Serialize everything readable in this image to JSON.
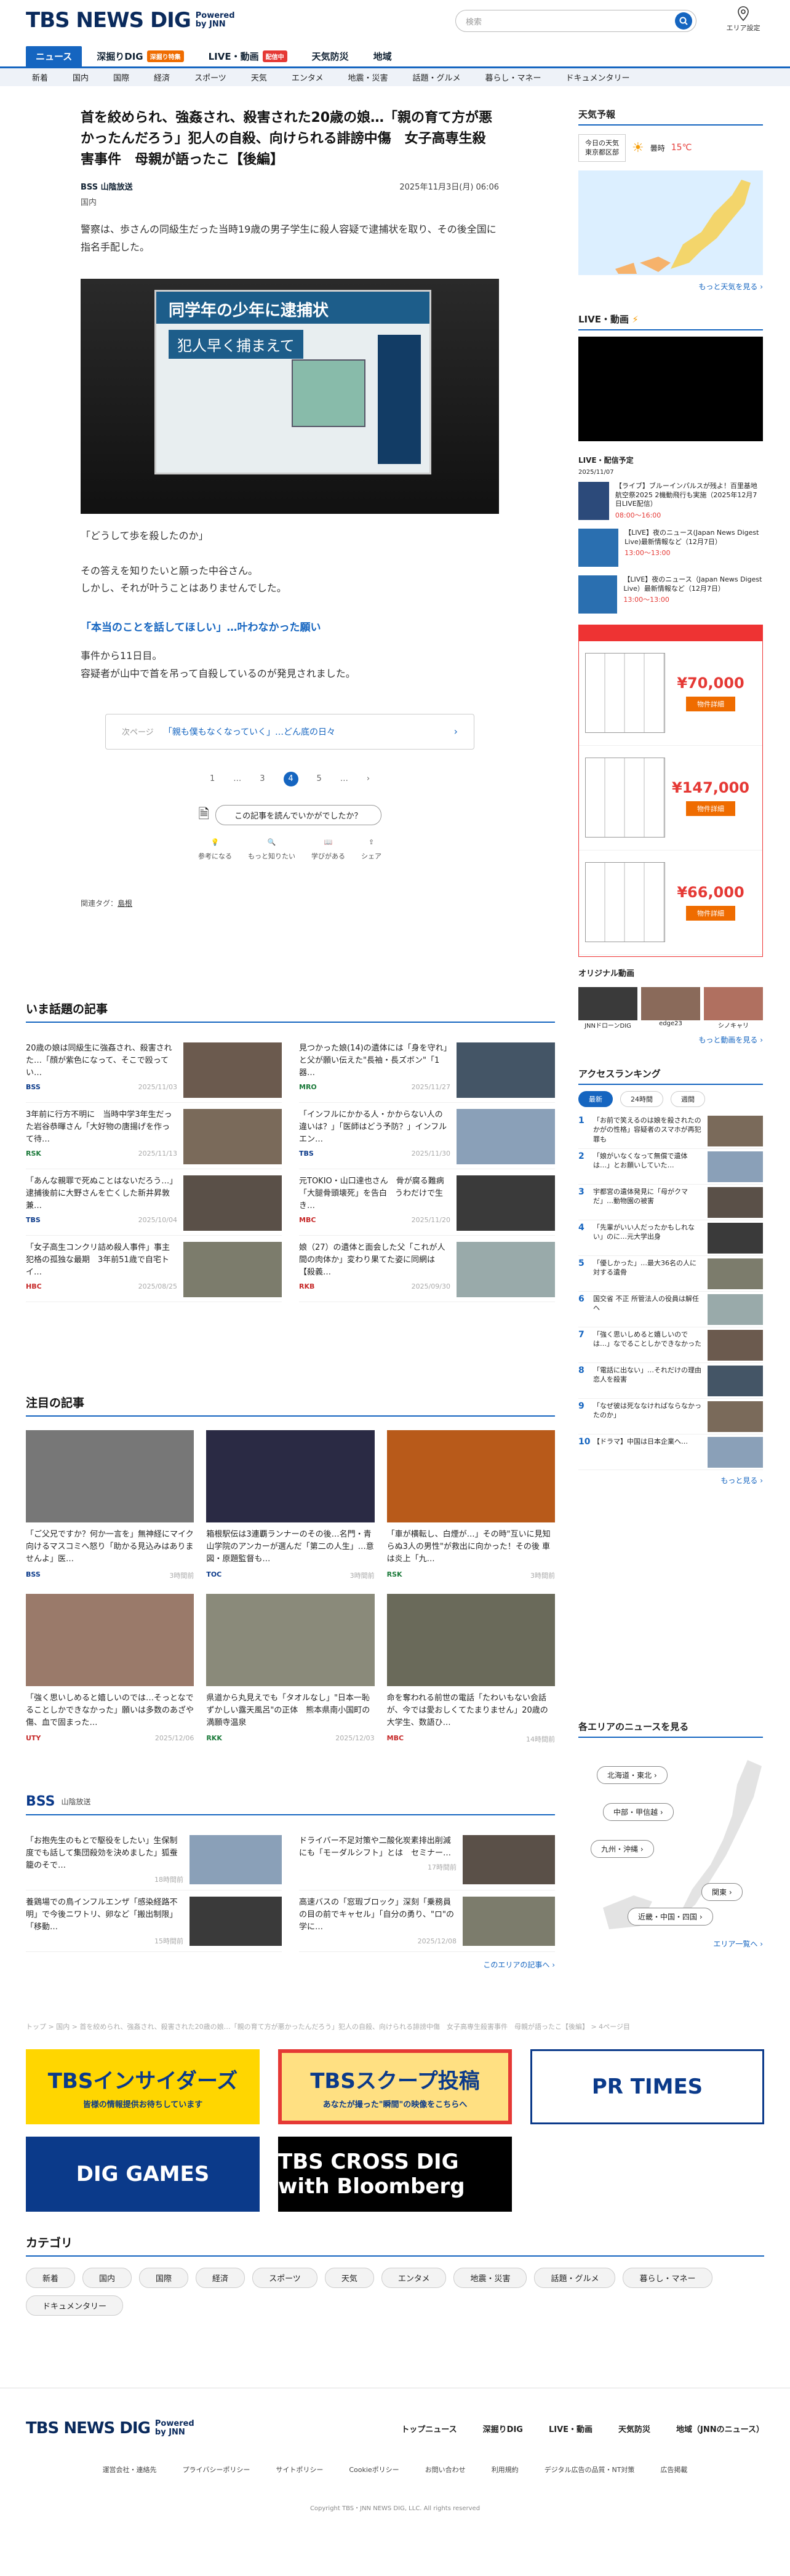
{
  "header": {
    "logo": "TBS NEWS DIG",
    "powered": "Powered by JNN",
    "search_placeholder": "検索",
    "area_label": "エリア設定"
  },
  "nav1": [
    {
      "label": "ニュース",
      "active": true
    },
    {
      "label": "深掘りDIG",
      "badge": "深掘り特集",
      "badge_color": "#ef6c00"
    },
    {
      "label": "LIVE・動画",
      "badge": "配信中",
      "badge_color": "#e53935"
    },
    {
      "label": "天気防災"
    },
    {
      "label": "地域"
    }
  ],
  "nav2": [
    "新着",
    "国内",
    "国際",
    "経済",
    "スポーツ",
    "天気",
    "エンタメ",
    "地震・災害",
    "話題・グルメ",
    "暮らし・マネー",
    "ドキュメンタリー"
  ],
  "article": {
    "title": "首を絞められ、強姦され、殺害された20歳の娘…「親の育て方が悪かったんだろう」犯人の自殺、向けられる誹謗中傷　女子高専生殺害事件　母親が語ったこ【後編】",
    "source": "BSS 山陰放送",
    "date": "2025年11月3日(月) 06:06",
    "category": "国内",
    "lead": "警察は、歩さんの同級生だった当時19歳の男子学生に殺人容疑で逮捕状を取り、その後全国に指名手配した。",
    "photo_band": "同学年の少年に逮捕状",
    "photo_band2": "犯人早く捕まえて",
    "p1": "「どうして歩を殺したのか」",
    "p2": "その答えを知りたいと願った中谷さん。",
    "p3": "しかし、それが叶うことはありませんでした。",
    "sub": "「本当のことを話してほしい」…叶わなかった願い",
    "p4": "事件から11日目。",
    "p5": "容疑者が山中で首を吊って自殺しているのが発見されました。",
    "next_label": "次ページ",
    "next_text": "「親も僕もなくなっていく」…どん底の日々",
    "pages": [
      "1",
      "…",
      "3",
      "4",
      "5",
      "…"
    ],
    "current_page": "4",
    "rate_q": "この記事を読んでいかがでしたか？",
    "reacts": [
      "参考になる",
      "もっと知りたい",
      "学びがある",
      "シェア"
    ],
    "tags_label": "関連タグ：",
    "tag": "島根"
  },
  "trending": {
    "title": "いま話題の記事",
    "items": [
      {
        "text": "20歳の娘は同級生に強姦され、殺害された…「顔が紫色になって、そこで殴ってい…",
        "src": "BSS",
        "date": "2025/11/03"
      },
      {
        "text": "見つかった娘(14)の遺体には「身を守れ」と父が願い伝えた\"長袖・長ズボン\"「1器…",
        "src": "MRO",
        "date": "2025/11/27"
      },
      {
        "text": "3年前に行方不明に　当時中学3年生だった岩谷恭暉さん「大好物の唐揚げを作って待…",
        "src": "RSK",
        "date": "2025/11/13"
      },
      {
        "text": "「インフルにかかる人・かからない人の違いは？」「医師はどう予防？」インフルエン…",
        "src": "TBS",
        "date": "2025/11/30"
      },
      {
        "text": "「あんな親罪で死ぬことはないだろう…」逮捕後前に大野さんを亡くした新井昇敦兼…",
        "src": "TBS",
        "date": "2025/10/04"
      },
      {
        "text": "元TOKIO・山口達也さん　骨が腐る難病「大腿骨頭壊死」を告白　うわだけで生き…",
        "src": "MBC",
        "date": "2025/11/20"
      },
      {
        "text": "「女子高生コンクリ詰め殺人事件」事主犯格の孤独な最期　3年前51歳で自宅トイ…",
        "src": "HBC",
        "date": "2025/08/25"
      },
      {
        "text": "娘（27）の遺体と面会した父「これが人間の肉体か」変わり果てた姿に同網は【殺義…",
        "src": "RKB",
        "date": "2025/09/30"
      }
    ]
  },
  "featured": {
    "title": "注目の記事",
    "items": [
      {
        "text": "「ご父兄ですか？何か一言を」無神経にマイク向けるマスコミへ怒り「助かる見込みはありませんよ」医…",
        "src": "BSS",
        "date": "3時間前"
      },
      {
        "text": "箱根駅伝は3連覇ランナーのその後…名門・青山学院のアンカーが選んだ「第二の人生」…意図・原題監督も…",
        "src": "TOC",
        "date": "3時間前"
      },
      {
        "text": "「車が横転し、白煙が…」その時\"互いに見知らぬ3人の男性\"が救出に向かった！その後 車は炎上「九…",
        "src": "RSK",
        "date": "3時間前"
      },
      {
        "text": "「強く思いしめると嬉しいのでは…そっとなでることしかできなかった」願いは多数のあざや傷、血で固まった…",
        "src": "UTY",
        "date": "2025/12/06"
      },
      {
        "text": "県道から丸見えでも「タオルなし」\"日本一恥ずかしい露天風呂\"の正体　熊本県南小国町の満願寺温泉",
        "src": "RKK",
        "date": "2025/12/03"
      },
      {
        "text": "命を奪われる前世の電話「たわいもない会話が、今では愛おしくてたまりません」20歳の大学生、数語ひ…",
        "src": "MBC",
        "date": "14時間前"
      }
    ]
  },
  "bss_sec": {
    "title": "山陰放送",
    "items": [
      {
        "text": "「お抱先生のもとで駆役をしたい」生保制度でも話して集団殺効を決めました」狐蚕籠のそで…",
        "date": "18時間前"
      },
      {
        "text": "ドライバー不足対策や二酸化炭素排出削減にも「モーダルシフト」とは　セミナー…",
        "date": "17時間前"
      },
      {
        "text": "養鶏場での鳥インフルエンザ「感染経路不明」で今後ニワトリ、卵など「搬出制限」「移動…",
        "date": "15時間前"
      },
      {
        "text": "高速バスの「窓瑕ブロック」深刻「乗務員の目の前でキャセル」「自分の勇り、\"ロ\"の学に…",
        "date": "2025/12/08"
      }
    ],
    "more": "このエリアの記事へ ›"
  },
  "side": {
    "weather_title": "天気予報",
    "weather_btn1": "今日の天気",
    "weather_btn2": "東京都区部",
    "weather_label": "曇時",
    "temp": "15℃",
    "weather_more": "もっと天気を見る ›",
    "live_title": "LIVE・動画",
    "sched_title": "LIVE・配信予定",
    "sched_date": "2025/11/07",
    "live_items": [
      {
        "text": "【ライブ】ブルーインパルスが残よ！百里基地航空祭2025 2機動飛行も実施（2025年12月7日LIVE配信）",
        "time": "08:00～16:00"
      },
      {
        "text": "【LIVE】夜のニュース(Japan News Digest Live)最新情報など（12月7日）",
        "time": "13:00～13:00"
      },
      {
        "text": "【LIVE】夜のニュース（Japan News Digest Live）最新情報など（12月7日）",
        "time": "13:00～13:00"
      }
    ],
    "ad_prices": [
      "¥70,000",
      "¥147,000",
      "¥66,000"
    ],
    "ad_btn": "物件詳細",
    "orig_title": "オリジナル動画",
    "orig": [
      "JNNドローンDIG",
      "edge23",
      "シノキャリ"
    ],
    "orig_more": "もっと動画を見る ›",
    "rank_title": "アクセスランキング",
    "rank_tabs": [
      "最新",
      "24時間",
      "週間"
    ],
    "ranks": [
      "「お前で笑えるのは娘を殺されたのかがの性格」容疑者のスマホが再犯罪も",
      "「娘がいなくなって無償で遺体は…」とお願いしていた…",
      "宇都宮の遺体発見に「母がクマだ」…動物園の被害",
      "「先輩がいい人だったかもしれない」のに…元大学出身",
      "「優しかった」…最大36名の人に対する遺骨",
      "国交省 不正 所管法人の役員は解任へ",
      "「強く思いしめると嬉しいのでは…」なでることしかできなかった",
      "「電話に出ない」…それだけの理由 恋人を殺害",
      "「なぜ彼は死ななければならなかったのか」",
      "【ドラマ】中国は日本企業へ…"
    ],
    "rank_more": "もっと見る ›",
    "region_title": "各エリアのニュースを見る",
    "regions": [
      "北海道・東北",
      "中部・甲信越",
      "九州・沖縄",
      "関東",
      "近畿・中国・四国"
    ],
    "region_more": "エリア一覧へ ›"
  },
  "breadcrumb": "トップ > 国内 > 首を絞められ、強姦され、殺害された20歳の娘…「親の育て方が悪かったんだろう」犯人の自殺、向けられる誹謗中傷　女子高専生殺害事件　母親が語ったこ【後編】 > 4ページ目",
  "banners": [
    "TBSインサイダーズ",
    "TBSスクープ投稿",
    "PR TIMES",
    "DIG GAMES",
    "TBS CROSS DIG with Bloomberg"
  ],
  "banner_sub": [
    "皆様の情報提供お待ちしています",
    "あなたが撮った\"瞬間\"の映像をこちらへ"
  ],
  "categories": {
    "title": "カテゴリ",
    "items": [
      "新着",
      "国内",
      "国際",
      "経済",
      "スポーツ",
      "天気",
      "エンタメ",
      "地震・災害",
      "話題・グルメ",
      "暮らし・マネー",
      "ドキュメンタリー"
    ]
  },
  "footer": {
    "links": [
      "トップニュース",
      "深掘りDIG",
      "LIVE・動画",
      "天気防災",
      "地域（JNNのニュース）"
    ],
    "links2": [
      "運営会社・連絡先",
      "プライバシーポリシー",
      "サイトポリシー",
      "Cookieポリシー",
      "お問い合わせ",
      "利用規約",
      "デジタル広告の品質・NT対策",
      "広告掲載"
    ],
    "copy": "Copyright TBS・JNN NEWS DIG, LLC. All rights reserved"
  }
}
